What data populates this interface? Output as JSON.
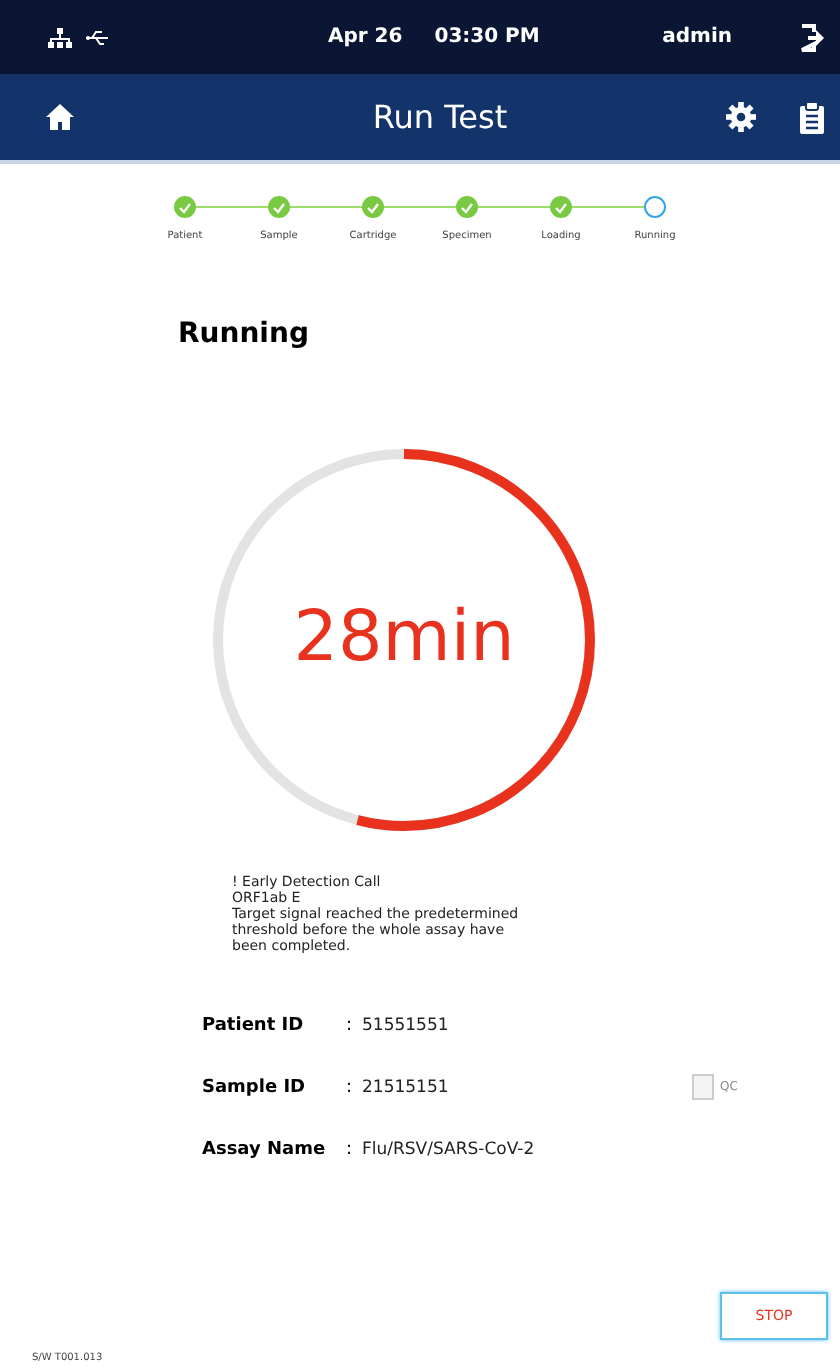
{
  "status_bar": {
    "date": "Apr 26",
    "time": "03:30 PM",
    "user": "admin"
  },
  "header": {
    "title": "Run Test"
  },
  "steps": [
    {
      "label": "Patient",
      "done": true
    },
    {
      "label": "Sample",
      "done": true
    },
    {
      "label": "Cartridge",
      "done": true
    },
    {
      "label": "Specimen",
      "done": true
    },
    {
      "label": "Loading",
      "done": true
    },
    {
      "label": "Running",
      "done": false
    }
  ],
  "section_title": "Running",
  "timer": {
    "text": "28min",
    "level": 0.54
  },
  "notice": [
    "! Early Detection Call",
    "ORF1ab E",
    "Target signal reached the predetermined threshold before the whole assay have been completed."
  ],
  "fields": [
    {
      "label": "Patient ID",
      "separator": ":",
      "value": "51551551"
    },
    {
      "label": "Sample ID",
      "separator": ":",
      "value": "21515151",
      "qc": {
        "label": "QC",
        "checked": false
      }
    },
    {
      "label": "Assay Name",
      "separator": ":",
      "value": "Flu/RSV/SARS-CoV-2"
    }
  ],
  "stop_button": "STOP",
  "version": "S/W T001.013"
}
